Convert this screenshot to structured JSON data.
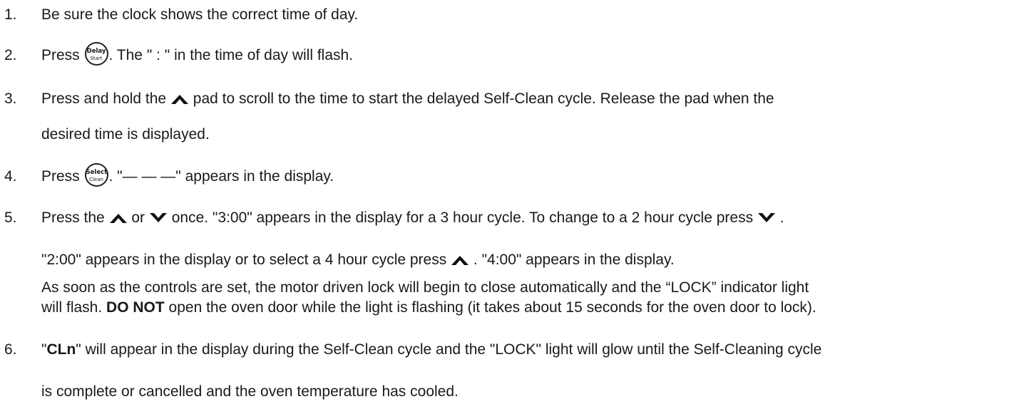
{
  "steps": [
    {
      "num": "1.",
      "text": "Be sure the clock shows the correct time of day."
    },
    {
      "num": "2.",
      "a": "Press ",
      "icon_line1": "Delay",
      "icon_line2": "Start",
      "b": ". The \" : \" in the time of day will flash."
    },
    {
      "num": "3.",
      "a": "Press and hold the ",
      "b": " pad to scroll to the time to start the delayed Self-Clean cycle. Release the pad when the",
      "c": "desired time is displayed."
    },
    {
      "num": "4.",
      "a": "Press ",
      "icon_line1": "Select",
      "icon_line2": "Clean",
      "b": ". \"— — —\" appears in the display."
    },
    {
      "num": "5.",
      "a": "Press the ",
      "b": " or ",
      "c": " once. \"3:00\" appears in the display for a 3 hour cycle. To change to a 2 hour cycle press ",
      "d": " .",
      "line2a": "\"2:00\" appears in the display or to select a 4 hour cycle press ",
      "line2b": " . \"4:00\" appears in the display.",
      "line3": "As soon as the controls are set, the motor driven lock will begin to close automatically and the “LOCK” indicator light",
      "line4a": "will flash. ",
      "line4b": "DO NOT",
      "line4c": " open the oven door while the light is flashing (it takes about 15 seconds for the oven door to lock)."
    },
    {
      "num": "6.",
      "a": "\"",
      "b": "CLn",
      "c": "\" will appear in the display during the Self-Clean cycle and the \"LOCK\" light will glow until the Self-Cleaning cycle",
      "line2": "is complete or cancelled and the oven temperature has cooled."
    }
  ],
  "icons": {
    "up": "chevron-up-icon",
    "down": "chevron-down-icon",
    "delay_start": "delay-start-button-icon",
    "select_clean": "select-clean-button-icon"
  }
}
